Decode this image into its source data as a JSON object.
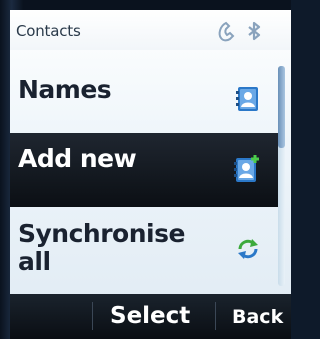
{
  "statusbar": {
    "title": "Contacts",
    "icons": [
      "phone-icon",
      "bluetooth-icon"
    ]
  },
  "menu": {
    "items": [
      {
        "label": "Names",
        "icon": "contact-card-icon",
        "selected": false
      },
      {
        "label": "Add new",
        "icon": "add-contact-icon",
        "selected": true
      },
      {
        "label_line1": "Synchronise",
        "label_line2": "all",
        "icon": "sync-icon",
        "selected": false
      }
    ]
  },
  "softkeys": {
    "left": "",
    "middle": "Select",
    "right": "Back"
  },
  "colors": {
    "accent": "#2b78c8",
    "highlight": "#0b0f14",
    "sync_green": "#3caa3c",
    "sync_blue": "#2b78c8"
  }
}
